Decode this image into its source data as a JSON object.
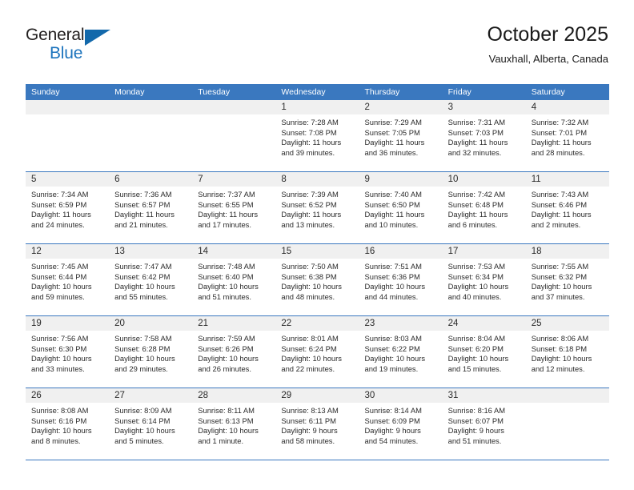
{
  "brand": {
    "name_top": "General",
    "name_bottom": "Blue",
    "accent_color": "#1369ab"
  },
  "header": {
    "title": "October 2025",
    "subtitle": "Vauxhall, Alberta, Canada"
  },
  "theme": {
    "header_blue": "#3a78bf",
    "day_band_gray": "#f0f0f0",
    "text": "#2b2b2b"
  },
  "weekdays": [
    "Sunday",
    "Monday",
    "Tuesday",
    "Wednesday",
    "Thursday",
    "Friday",
    "Saturday"
  ],
  "weeks": [
    [
      {
        "day": "",
        "sunrise": "",
        "sunset": "",
        "daylight1": "",
        "daylight2": ""
      },
      {
        "day": "",
        "sunrise": "",
        "sunset": "",
        "daylight1": "",
        "daylight2": ""
      },
      {
        "day": "",
        "sunrise": "",
        "sunset": "",
        "daylight1": "",
        "daylight2": ""
      },
      {
        "day": "1",
        "sunrise": "Sunrise: 7:28 AM",
        "sunset": "Sunset: 7:08 PM",
        "daylight1": "Daylight: 11 hours",
        "daylight2": "and 39 minutes."
      },
      {
        "day": "2",
        "sunrise": "Sunrise: 7:29 AM",
        "sunset": "Sunset: 7:05 PM",
        "daylight1": "Daylight: 11 hours",
        "daylight2": "and 36 minutes."
      },
      {
        "day": "3",
        "sunrise": "Sunrise: 7:31 AM",
        "sunset": "Sunset: 7:03 PM",
        "daylight1": "Daylight: 11 hours",
        "daylight2": "and 32 minutes."
      },
      {
        "day": "4",
        "sunrise": "Sunrise: 7:32 AM",
        "sunset": "Sunset: 7:01 PM",
        "daylight1": "Daylight: 11 hours",
        "daylight2": "and 28 minutes."
      }
    ],
    [
      {
        "day": "5",
        "sunrise": "Sunrise: 7:34 AM",
        "sunset": "Sunset: 6:59 PM",
        "daylight1": "Daylight: 11 hours",
        "daylight2": "and 24 minutes."
      },
      {
        "day": "6",
        "sunrise": "Sunrise: 7:36 AM",
        "sunset": "Sunset: 6:57 PM",
        "daylight1": "Daylight: 11 hours",
        "daylight2": "and 21 minutes."
      },
      {
        "day": "7",
        "sunrise": "Sunrise: 7:37 AM",
        "sunset": "Sunset: 6:55 PM",
        "daylight1": "Daylight: 11 hours",
        "daylight2": "and 17 minutes."
      },
      {
        "day": "8",
        "sunrise": "Sunrise: 7:39 AM",
        "sunset": "Sunset: 6:52 PM",
        "daylight1": "Daylight: 11 hours",
        "daylight2": "and 13 minutes."
      },
      {
        "day": "9",
        "sunrise": "Sunrise: 7:40 AM",
        "sunset": "Sunset: 6:50 PM",
        "daylight1": "Daylight: 11 hours",
        "daylight2": "and 10 minutes."
      },
      {
        "day": "10",
        "sunrise": "Sunrise: 7:42 AM",
        "sunset": "Sunset: 6:48 PM",
        "daylight1": "Daylight: 11 hours",
        "daylight2": "and 6 minutes."
      },
      {
        "day": "11",
        "sunrise": "Sunrise: 7:43 AM",
        "sunset": "Sunset: 6:46 PM",
        "daylight1": "Daylight: 11 hours",
        "daylight2": "and 2 minutes."
      }
    ],
    [
      {
        "day": "12",
        "sunrise": "Sunrise: 7:45 AM",
        "sunset": "Sunset: 6:44 PM",
        "daylight1": "Daylight: 10 hours",
        "daylight2": "and 59 minutes."
      },
      {
        "day": "13",
        "sunrise": "Sunrise: 7:47 AM",
        "sunset": "Sunset: 6:42 PM",
        "daylight1": "Daylight: 10 hours",
        "daylight2": "and 55 minutes."
      },
      {
        "day": "14",
        "sunrise": "Sunrise: 7:48 AM",
        "sunset": "Sunset: 6:40 PM",
        "daylight1": "Daylight: 10 hours",
        "daylight2": "and 51 minutes."
      },
      {
        "day": "15",
        "sunrise": "Sunrise: 7:50 AM",
        "sunset": "Sunset: 6:38 PM",
        "daylight1": "Daylight: 10 hours",
        "daylight2": "and 48 minutes."
      },
      {
        "day": "16",
        "sunrise": "Sunrise: 7:51 AM",
        "sunset": "Sunset: 6:36 PM",
        "daylight1": "Daylight: 10 hours",
        "daylight2": "and 44 minutes."
      },
      {
        "day": "17",
        "sunrise": "Sunrise: 7:53 AM",
        "sunset": "Sunset: 6:34 PM",
        "daylight1": "Daylight: 10 hours",
        "daylight2": "and 40 minutes."
      },
      {
        "day": "18",
        "sunrise": "Sunrise: 7:55 AM",
        "sunset": "Sunset: 6:32 PM",
        "daylight1": "Daylight: 10 hours",
        "daylight2": "and 37 minutes."
      }
    ],
    [
      {
        "day": "19",
        "sunrise": "Sunrise: 7:56 AM",
        "sunset": "Sunset: 6:30 PM",
        "daylight1": "Daylight: 10 hours",
        "daylight2": "and 33 minutes."
      },
      {
        "day": "20",
        "sunrise": "Sunrise: 7:58 AM",
        "sunset": "Sunset: 6:28 PM",
        "daylight1": "Daylight: 10 hours",
        "daylight2": "and 29 minutes."
      },
      {
        "day": "21",
        "sunrise": "Sunrise: 7:59 AM",
        "sunset": "Sunset: 6:26 PM",
        "daylight1": "Daylight: 10 hours",
        "daylight2": "and 26 minutes."
      },
      {
        "day": "22",
        "sunrise": "Sunrise: 8:01 AM",
        "sunset": "Sunset: 6:24 PM",
        "daylight1": "Daylight: 10 hours",
        "daylight2": "and 22 minutes."
      },
      {
        "day": "23",
        "sunrise": "Sunrise: 8:03 AM",
        "sunset": "Sunset: 6:22 PM",
        "daylight1": "Daylight: 10 hours",
        "daylight2": "and 19 minutes."
      },
      {
        "day": "24",
        "sunrise": "Sunrise: 8:04 AM",
        "sunset": "Sunset: 6:20 PM",
        "daylight1": "Daylight: 10 hours",
        "daylight2": "and 15 minutes."
      },
      {
        "day": "25",
        "sunrise": "Sunrise: 8:06 AM",
        "sunset": "Sunset: 6:18 PM",
        "daylight1": "Daylight: 10 hours",
        "daylight2": "and 12 minutes."
      }
    ],
    [
      {
        "day": "26",
        "sunrise": "Sunrise: 8:08 AM",
        "sunset": "Sunset: 6:16 PM",
        "daylight1": "Daylight: 10 hours",
        "daylight2": "and 8 minutes."
      },
      {
        "day": "27",
        "sunrise": "Sunrise: 8:09 AM",
        "sunset": "Sunset: 6:14 PM",
        "daylight1": "Daylight: 10 hours",
        "daylight2": "and 5 minutes."
      },
      {
        "day": "28",
        "sunrise": "Sunrise: 8:11 AM",
        "sunset": "Sunset: 6:13 PM",
        "daylight1": "Daylight: 10 hours",
        "daylight2": "and 1 minute."
      },
      {
        "day": "29",
        "sunrise": "Sunrise: 8:13 AM",
        "sunset": "Sunset: 6:11 PM",
        "daylight1": "Daylight: 9 hours",
        "daylight2": "and 58 minutes."
      },
      {
        "day": "30",
        "sunrise": "Sunrise: 8:14 AM",
        "sunset": "Sunset: 6:09 PM",
        "daylight1": "Daylight: 9 hours",
        "daylight2": "and 54 minutes."
      },
      {
        "day": "31",
        "sunrise": "Sunrise: 8:16 AM",
        "sunset": "Sunset: 6:07 PM",
        "daylight1": "Daylight: 9 hours",
        "daylight2": "and 51 minutes."
      },
      {
        "day": "",
        "sunrise": "",
        "sunset": "",
        "daylight1": "",
        "daylight2": ""
      }
    ]
  ]
}
